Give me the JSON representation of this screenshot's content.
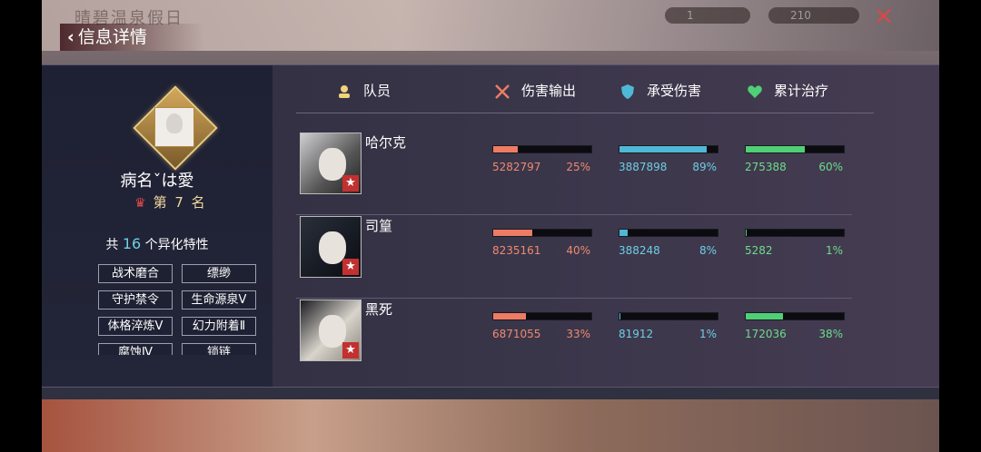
{
  "topbar": {
    "title": "晴碧温泉假日",
    "counter1": "1",
    "counter2": "210"
  },
  "back": {
    "label": "信息详情"
  },
  "player": {
    "name": "病名ˇは愛",
    "rank": "第 7 名"
  },
  "traits": {
    "prefix": "共",
    "count": "16",
    "suffix": "个异化特性",
    "items": [
      "战术磨合",
      "缥缈",
      "守护禁令",
      "生命源泉Ⅴ",
      "体格淬炼Ⅴ",
      "幻力附着Ⅱ",
      "腐蚀Ⅳ",
      "锁链"
    ]
  },
  "headers": {
    "member": "队员",
    "damage": "伤害输出",
    "taken": "承受伤害",
    "heal": "累计治疗"
  },
  "colors": {
    "damage": "#ee7b63",
    "taken": "#4fb8d6",
    "heal": "#4fcf76"
  },
  "members": [
    {
      "name": "哈尔克",
      "damage": "5282797",
      "damage_pct": "25%",
      "damage_frac": 0.25,
      "taken": "3887898",
      "taken_pct": "89%",
      "taken_frac": 0.89,
      "heal": "275388",
      "heal_pct": "60%",
      "heal_frac": 0.6
    },
    {
      "name": "司篁",
      "damage": "8235161",
      "damage_pct": "40%",
      "damage_frac": 0.4,
      "taken": "388248",
      "taken_pct": "8%",
      "taken_frac": 0.08,
      "heal": "5282",
      "heal_pct": "1%",
      "heal_frac": 0.01
    },
    {
      "name": "黑死",
      "damage": "6871055",
      "damage_pct": "33%",
      "damage_frac": 0.33,
      "taken": "81912",
      "taken_pct": "1%",
      "taken_frac": 0.01,
      "heal": "172036",
      "heal_pct": "38%",
      "heal_frac": 0.38
    }
  ]
}
